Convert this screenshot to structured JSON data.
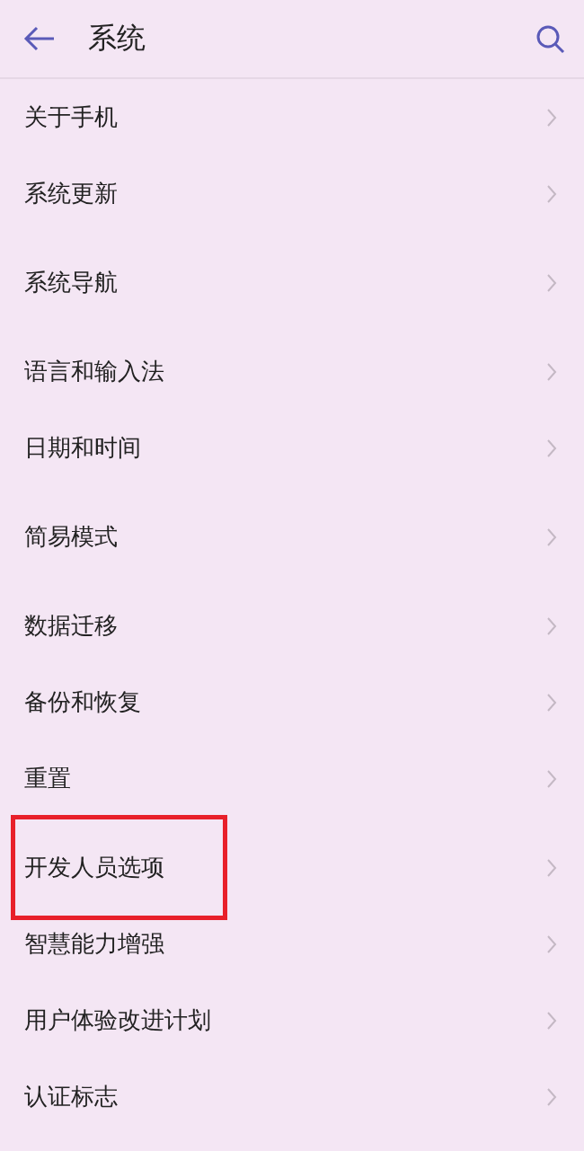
{
  "header": {
    "title": "系统"
  },
  "groups": [
    {
      "items": [
        {
          "label": "关于手机",
          "highlighted": false
        },
        {
          "label": "系统更新",
          "highlighted": false
        }
      ]
    },
    {
      "items": [
        {
          "label": "系统导航",
          "highlighted": false
        }
      ]
    },
    {
      "items": [
        {
          "label": "语言和输入法",
          "highlighted": false
        },
        {
          "label": "日期和时间",
          "highlighted": false
        }
      ]
    },
    {
      "items": [
        {
          "label": "简易模式",
          "highlighted": false
        }
      ]
    },
    {
      "items": [
        {
          "label": "数据迁移",
          "highlighted": false
        },
        {
          "label": "备份和恢复",
          "highlighted": false
        },
        {
          "label": "重置",
          "highlighted": false
        }
      ]
    },
    {
      "items": [
        {
          "label": "开发人员选项",
          "highlighted": true
        },
        {
          "label": "智慧能力增强",
          "highlighted": false
        },
        {
          "label": "用户体验改进计划",
          "highlighted": false
        },
        {
          "label": "认证标志",
          "highlighted": false
        }
      ]
    }
  ]
}
